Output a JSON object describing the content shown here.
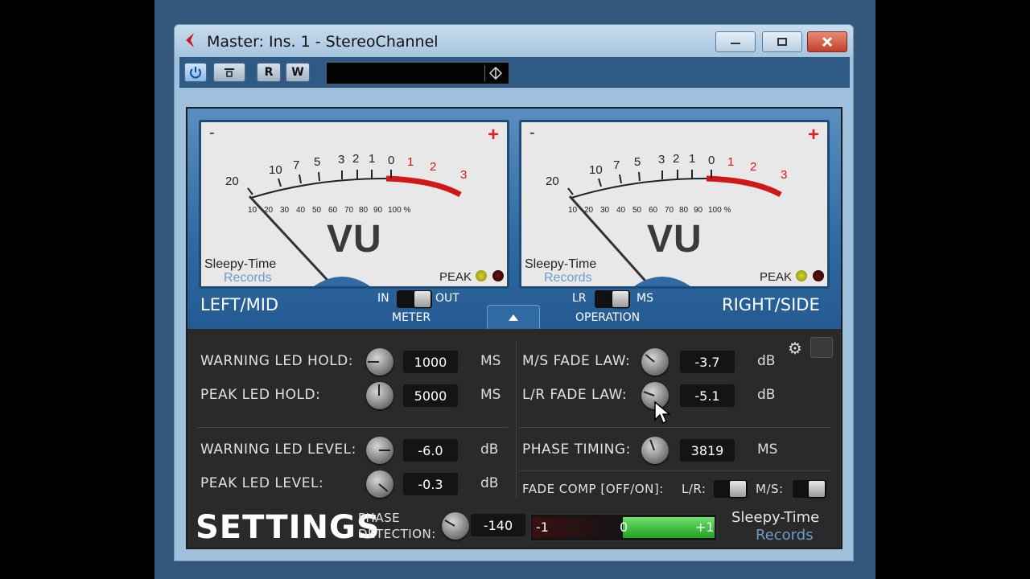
{
  "window": {
    "title": "Master: Ins. 1 - StereoChannel",
    "controls": {
      "minimize": "minimize",
      "maximize": "maximize",
      "close": "close"
    }
  },
  "toolbar": {
    "power_icon": "power-icon",
    "bypass_icon": "bypass-icon",
    "read_label": "R",
    "write_label": "W",
    "preset_name": ""
  },
  "meters": {
    "left": {
      "minus": "-",
      "plus": "+",
      "vu": "VU",
      "brand_line1": "Sleepy-Time",
      "brand_line2": "Records",
      "peak": "PEAK",
      "db_scale": [
        "20",
        "10",
        "7",
        "5",
        "3",
        "2",
        "1",
        "0",
        "1",
        "2",
        "3"
      ],
      "pct_scale": [
        "10",
        "20",
        "30",
        "40",
        "50",
        "60",
        "70",
        "80",
        "90",
        "100 %"
      ]
    },
    "right": {
      "minus": "-",
      "plus": "+",
      "vu": "VU",
      "brand_line1": "Sleepy-Time",
      "brand_line2": "Records",
      "peak": "PEAK",
      "db_scale": [
        "20",
        "10",
        "7",
        "5",
        "3",
        "2",
        "1",
        "0",
        "1",
        "2",
        "3"
      ],
      "pct_scale": [
        "10",
        "20",
        "30",
        "40",
        "50",
        "60",
        "70",
        "80",
        "90",
        "100 %"
      ]
    }
  },
  "channels": {
    "left_label": "LEFT/MID",
    "right_label": "RIGHT/SIDE"
  },
  "switches": {
    "meter": {
      "label": "METER",
      "left": "IN",
      "right": "OUT",
      "state": "OUT"
    },
    "operation": {
      "label": "OPERATION",
      "left": "LR",
      "right": "MS",
      "state": "MS"
    }
  },
  "settings": {
    "title": "SETTINGS",
    "warning_led_hold": {
      "label": "WARNING LED HOLD:",
      "value": "1000",
      "unit": "MS"
    },
    "peak_led_hold": {
      "label": "PEAK LED HOLD:",
      "value": "5000",
      "unit": "MS"
    },
    "warning_led_level": {
      "label": "WARNING LED LEVEL:",
      "value": "-6.0",
      "unit": "dB"
    },
    "peak_led_level": {
      "label": "PEAK LED LEVEL:",
      "value": "-0.3",
      "unit": "dB"
    },
    "ms_fade_law": {
      "label": "M/S FADE LAW:",
      "value": "-3.7",
      "unit": "dB"
    },
    "lr_fade_law": {
      "label": "L/R FADE LAW:",
      "value": "-5.1",
      "unit": "dB"
    },
    "phase_timing": {
      "label": "PHASE TIMING:",
      "value": "3819",
      "unit": "MS"
    },
    "fade_comp": {
      "label": "FADE COMP [OFF/ON]:",
      "lr_label": "L/R:",
      "ms_label": "M/S:"
    },
    "phase_detection": {
      "label_line1": "PHASE",
      "label_line2": "DETECTION:",
      "value": "-140"
    },
    "phase_meter": {
      "min": "-1",
      "mid": "0",
      "max": "+1",
      "level": 1.0
    },
    "brand_line1": "Sleepy-Time",
    "brand_line2": "Records",
    "gear_icon": "gear-icon"
  },
  "colors": {
    "accent_blue": "#2f6aa3",
    "led_green": "#35c035",
    "needle_red": "#d01818"
  }
}
